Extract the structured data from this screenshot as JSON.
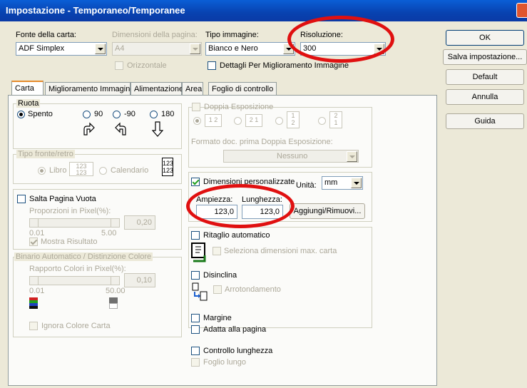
{
  "window": {
    "title": "Impostazione - Temporaneo/Temporanee"
  },
  "top": {
    "paper_source_label": "Fonte della carta:",
    "paper_source_value": "ADF Simplex",
    "page_size_label": "Dimensioni della pagina:",
    "page_size_value": "A4",
    "landscape_label": "Orizzontale",
    "image_type_label": "Tipo immagine:",
    "image_type_value": "Bianco e Nero",
    "enhancement_details_label": "Dettagli Per Miglioramento Immagine",
    "resolution_label": "Risoluzione:",
    "resolution_value": "300"
  },
  "side_buttons": {
    "ok": "OK",
    "save": "Salva impostazione...",
    "default": "Default",
    "cancel": "Annulla",
    "help": "Guida"
  },
  "tabs": [
    "Carta",
    "Miglioramento Immagine",
    "Alimentazione",
    "Area",
    "Foglio di controllo"
  ],
  "rotate": {
    "title": "Ruota",
    "off": "Spento",
    "r90": "90",
    "rm90": "-90",
    "r180": "180"
  },
  "duplex": {
    "title": "Tipo fronte/retro",
    "book": "Libro",
    "calendar": "Calendario",
    "book_icon_text": "123 123",
    "calendar_icon_text": "123 123"
  },
  "blank_page": {
    "skip_label": "Salta Pagina Vuota",
    "ratio_label": "Proporzioni in Pixel(%):",
    "value": "0,20",
    "min": "0.01",
    "max": "5.00",
    "show_result": "Mostra Risultato"
  },
  "color_separation": {
    "title": "Binario Automatico / Distinzione Colore",
    "ratio_label": "Rapporto Colori in Pixel(%):",
    "value": "0,10",
    "min": "0.01",
    "max": "50.00",
    "ignore_paper_color": "Ignora Colore Carta"
  },
  "double_exposure": {
    "title": "Doppia Esposizione",
    "opt1": "1 2",
    "opt2": "2 1",
    "opt3_top": "1",
    "opt3_bottom": "2",
    "opt4_top": "2",
    "opt4_bottom": "1",
    "format_label": "Formato doc. prima Doppia Esposizione:",
    "format_value": "Nessuno"
  },
  "custom_size": {
    "label": "Dimensioni personalizzate",
    "unit_label": "Unità:",
    "unit_value": "mm",
    "width_label": "Ampiezza:",
    "width_value": "123,0",
    "length_label": "Lunghezza:",
    "length_value": "123,0",
    "add_remove": "Aggiungi/Rimuovi..."
  },
  "crop": {
    "auto_crop": "Ritaglio automatico",
    "select_max": "Seleziona dimensioni max. carta"
  },
  "deskew": {
    "label": "Disinclina",
    "rounding": "Arrotondamento"
  },
  "misc": {
    "margin": "Margine",
    "fit_page": "Adatta alla pagina",
    "length_control": "Controllo lunghezza",
    "long_sheet": "Foglio lungo"
  },
  "colors": {
    "titlebar": "#0842b0",
    "annotation": "#e01010",
    "active_tab": "#e68b2c"
  }
}
